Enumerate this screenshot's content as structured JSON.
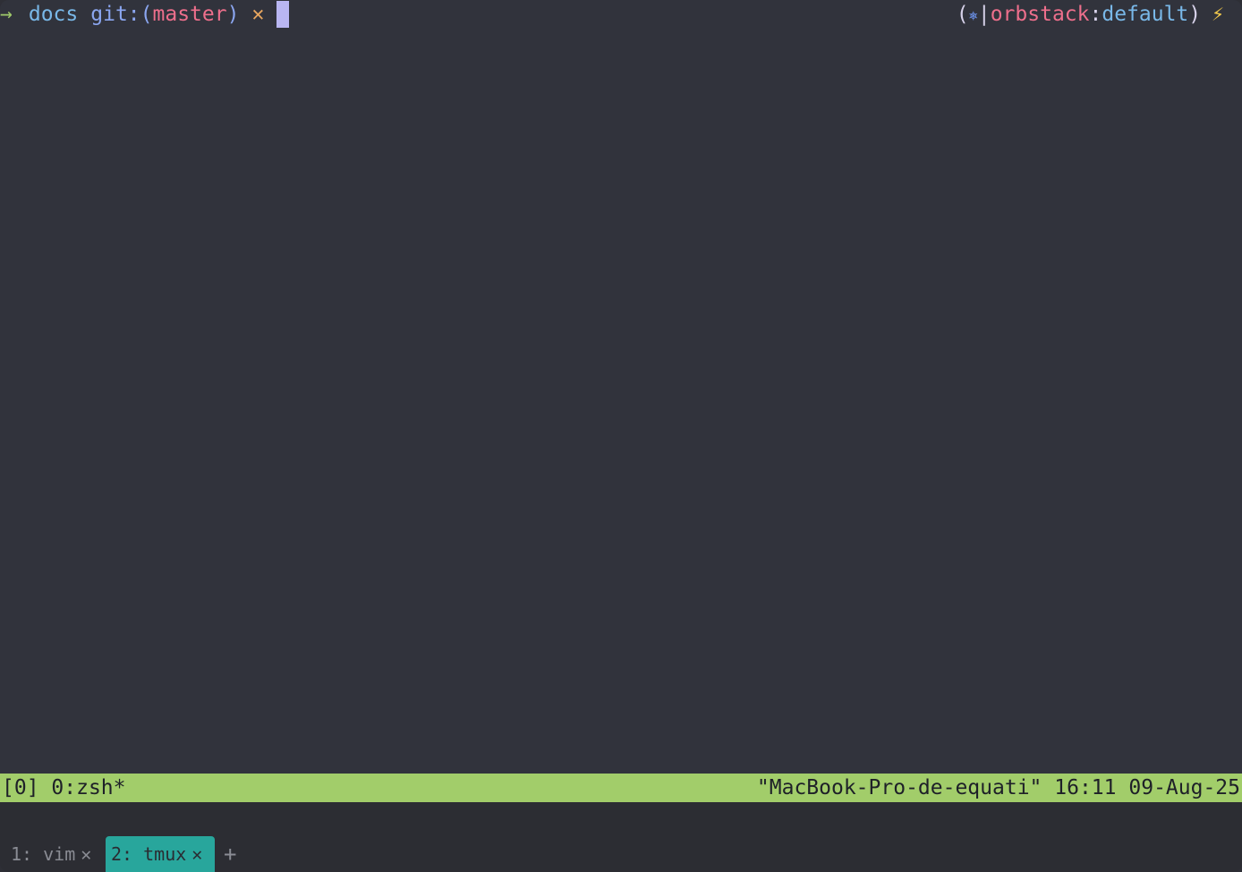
{
  "prompt": {
    "arrow": "→",
    "directory": "docs",
    "git_label": "git:",
    "branch_open": "(",
    "branch": "master",
    "branch_close": ")",
    "dirty_marker": "✕",
    "k8s_open": "(",
    "k8s_icon": "⎈",
    "k8s_sep": "|",
    "k8s_context": "orbstack",
    "k8s_colon": ":",
    "k8s_namespace": "default",
    "k8s_close": ")",
    "bolt": "⚡"
  },
  "status_bar": {
    "session": "[0]",
    "window": "0:zsh*",
    "host": "\"MacBook-Pro-de-equati\"",
    "time": "16:11",
    "date": "09-Aug-25"
  },
  "tabs": [
    {
      "label": "1: vim",
      "close": "✕",
      "active": false
    },
    {
      "label": "2: tmux",
      "close": "✕",
      "active": true
    }
  ],
  "new_tab_label": "+",
  "colors": {
    "background": "#31333c",
    "status_bar": "#a2cd6a",
    "active_tab": "#28a69c",
    "cursor": "#b9b6f2"
  }
}
